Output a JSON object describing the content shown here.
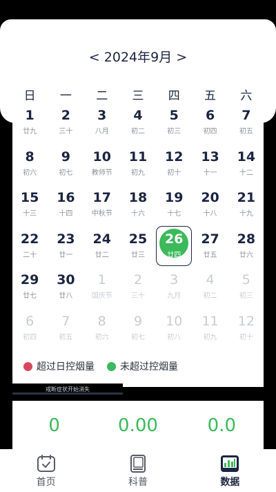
{
  "calendar": {
    "prev_label": "<",
    "month_label": "2024年9月",
    "next_label": ">",
    "weekdays": [
      "日",
      "一",
      "二",
      "三",
      "四",
      "五",
      "六"
    ],
    "days": [
      {
        "d": "1",
        "l": "廿九"
      },
      {
        "d": "2",
        "l": "三十"
      },
      {
        "d": "3",
        "l": "八月"
      },
      {
        "d": "4",
        "l": "初二"
      },
      {
        "d": "5",
        "l": "初三"
      },
      {
        "d": "6",
        "l": "初四"
      },
      {
        "d": "7",
        "l": "初五"
      },
      {
        "d": "8",
        "l": "初六"
      },
      {
        "d": "9",
        "l": "初七"
      },
      {
        "d": "10",
        "l": "教师节"
      },
      {
        "d": "11",
        "l": "初九"
      },
      {
        "d": "12",
        "l": "初十"
      },
      {
        "d": "13",
        "l": "十一"
      },
      {
        "d": "14",
        "l": "十二"
      },
      {
        "d": "15",
        "l": "十三"
      },
      {
        "d": "16",
        "l": "十四"
      },
      {
        "d": "17",
        "l": "中秋节"
      },
      {
        "d": "18",
        "l": "十六"
      },
      {
        "d": "19",
        "l": "十七"
      },
      {
        "d": "20",
        "l": "十八"
      },
      {
        "d": "21",
        "l": "十九"
      },
      {
        "d": "22",
        "l": "二十"
      },
      {
        "d": "23",
        "l": "廿一"
      },
      {
        "d": "24",
        "l": "廿二"
      },
      {
        "d": "25",
        "l": "廿三"
      },
      {
        "d": "26",
        "l": "廿四",
        "selected": true
      },
      {
        "d": "27",
        "l": "廿五"
      },
      {
        "d": "28",
        "l": "廿六"
      },
      {
        "d": "29",
        "l": "廿七"
      },
      {
        "d": "30",
        "l": "廿八"
      },
      {
        "d": "1",
        "l": "国庆节",
        "faded": true
      },
      {
        "d": "2",
        "l": "三十",
        "faded": true
      },
      {
        "d": "3",
        "l": "九月",
        "faded": true
      },
      {
        "d": "4",
        "l": "初二",
        "faded": true
      },
      {
        "d": "5",
        "l": "初三",
        "faded": true
      },
      {
        "d": "6",
        "l": "初四",
        "faded": true
      },
      {
        "d": "7",
        "l": "初五",
        "faded": true
      },
      {
        "d": "8",
        "l": "初六",
        "faded": true
      },
      {
        "d": "9",
        "l": "初七",
        "faded": true
      },
      {
        "d": "10",
        "l": "初八",
        "faded": true
      },
      {
        "d": "11",
        "l": "初九",
        "faded": true
      },
      {
        "d": "12",
        "l": "初十",
        "faded": true
      }
    ]
  },
  "legend": {
    "over_label": "超过日控烟量",
    "over_color": "#d9475c",
    "under_label": "未超过控烟量",
    "under_color": "#3cb95a"
  },
  "banner": {
    "text": "戒断症状开始消失"
  },
  "stats": {
    "values": [
      "0",
      "0.00",
      "0.0"
    ]
  },
  "tabs": [
    {
      "label": "首页",
      "icon": "calendar-check-icon"
    },
    {
      "label": "科普",
      "icon": "book-icon"
    },
    {
      "label": "数据",
      "icon": "chart-icon",
      "active": true
    }
  ],
  "colors": {
    "accent": "#3cb95a",
    "text": "#1b2440"
  }
}
